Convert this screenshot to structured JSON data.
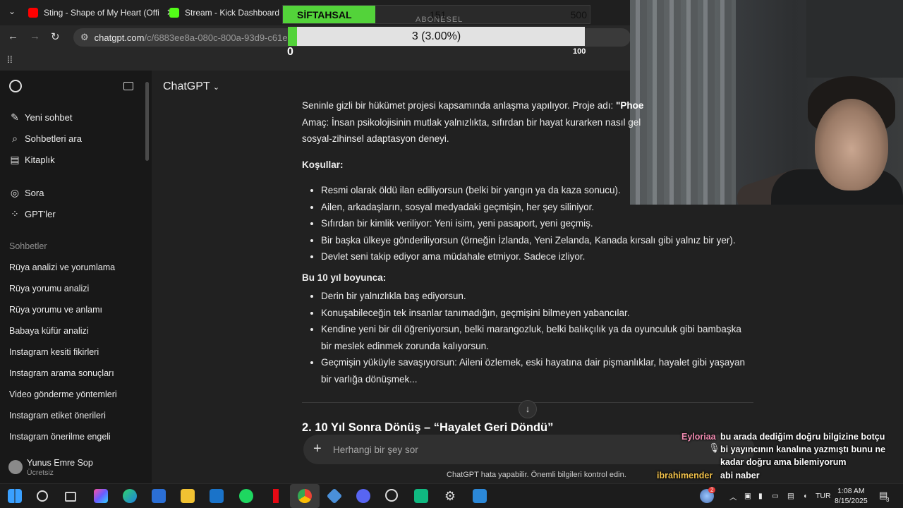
{
  "browser": {
    "tabs": [
      {
        "title": "Sting - Shape of My Heart (Offi",
        "close": "✕"
      },
      {
        "title": "Stream - Kick Dashboard"
      }
    ],
    "url_main": "chatgpt.com",
    "url_rest": "/c/6883ee8a-080c-800a-93d9-c61edd856"
  },
  "overlay": {
    "goal1": {
      "label": "SİFTAHSAL",
      "current": "151",
      "max": "500",
      "sub": "ABONESEL",
      "progress": 0.302
    },
    "goal2": {
      "value": "3 (3.00%)",
      "min": "0",
      "max": "100",
      "progress": 0.03
    }
  },
  "sidebar": {
    "items": [
      {
        "icon": "✎",
        "label": "Yeni sohbet"
      },
      {
        "icon": "⌕",
        "label": "Sohbetleri ara"
      },
      {
        "icon": "▤",
        "label": "Kitaplık"
      },
      {
        "icon": "◎",
        "label": "Sora"
      },
      {
        "icon": "⁘",
        "label": "GPT'ler"
      }
    ],
    "section": "Sohbetler",
    "chats": [
      "Rüya analizi ve yorumlama",
      "Rüya yorumu analizi",
      "Rüya yorumu ve anlamı",
      "Babaya küfür analizi",
      "Instagram kesiti fikirleri",
      "Instagram arama sonuçları",
      "Video gönderme yöntemleri",
      "Instagram etiket önerileri",
      "Instagram önerilme engeli"
    ],
    "user": {
      "name": "Yunus Emre Sop",
      "plan": "Ücretsiz"
    }
  },
  "main": {
    "model": "ChatGPT",
    "intro_1": "Seninle gizli bir hükümet projesi kapsamında anlaşma yapılıyor. Proje adı: ",
    "intro_bold": "\"Phoe",
    "intro_2": "Amaç: İnsan psikolojisinin mutlak yalnızlıkta, sıfırdan bir hayat kurarken nasıl gel",
    "intro_3": "sosyal-zihinsel adaptasyon deneyi.",
    "conditions_title": "Koşullar:",
    "conditions": [
      "Resmi olarak öldü ilan ediliyorsun (belki bir yangın ya da kaza sonucu).",
      "Ailen, arkadaşların, sosyal medyadaki geçmişin, her şey siliniyor.",
      "Sıfırdan bir kimlik veriliyor: Yeni isim, yeni pasaport, yeni geçmiş.",
      "Bir başka ülkeye gönderiliyorsun (örneğin İzlanda, Yeni Zelanda, Kanada kırsalı gibi yalnız bir yer).",
      "Devlet seni takip ediyor ama müdahale etmiyor. Sadece izliyor."
    ],
    "years_title": "Bu 10 yıl boyunca:",
    "years": [
      "Derin bir yalnızlıkla baş ediyorsun.",
      "Konuşabileceğin tek insanlar tanımadığın, geçmişini bilmeyen yabancılar.",
      "Kendine yeni bir dil öğreniyorsun, belki marangozluk, belki balıkçılık ya da oyunculuk gibi bambaşka bir meslek edinmek zorunda kalıyorsun.",
      "Geçmişin yüküyle savaşıyorsun: Aileni özlemek, eski hayatına dair pişmanlıklar, hayalet gibi yaşayan bir varlığa dönüşmek..."
    ],
    "section2": "2. 10 Yıl Sonra Dönüş – “Hayalet Geri Döndü”",
    "composer_placeholder": "Herhangi bir şey sor",
    "disclaimer": "ChatGPT hata yapabilir. Önemli bilgileri kontrol edin."
  },
  "stream_chat": [
    {
      "user": "Eyloriaa",
      "lines": [
        "bu arada dediğim doğru bilgizine botçu",
        "bi yayıncının kanalına yazmıştı bunu ne",
        "kadar doğru ama bilemiyorum"
      ]
    },
    {
      "user": "ibrahimender",
      "lines": [
        "abi naber"
      ]
    }
  ],
  "taskbar": {
    "lang": "TUR",
    "time": "1:08 AM",
    "date": "8/15/2025",
    "notif_count": "3",
    "weather_badge": "2"
  },
  "colors": {
    "accent_green": "#53d33a",
    "youtube_red": "#ff0000",
    "kick_green": "#53fc18"
  }
}
